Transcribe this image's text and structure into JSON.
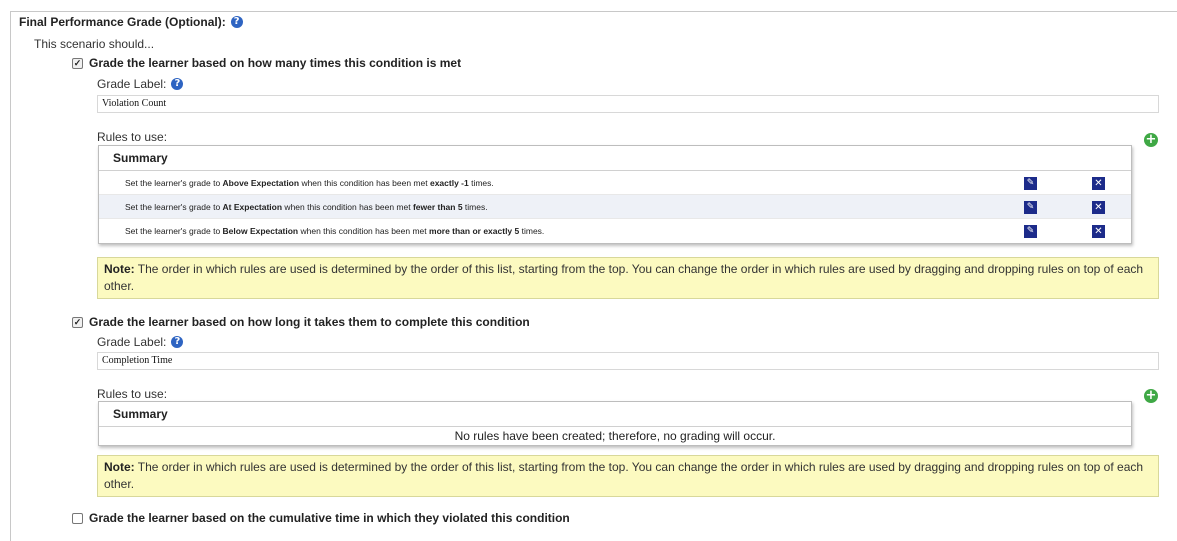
{
  "legend": {
    "label": "Final Performance Grade (Optional):",
    "help_icon": "question-circle-icon"
  },
  "intro": "This scenario should...",
  "sections": [
    {
      "checked": true,
      "checkbox_label": "Grade the learner based on how many times this condition is met",
      "grade_label": "Grade Label:",
      "grade_value": "Violation Count",
      "rules_label": "Rules to use:",
      "table_header": "Summary",
      "rules": [
        {
          "prefix": "Set the learner's grade to ",
          "grade": "Above Expectation",
          "middle": " when this condition has been met ",
          "cond": "exactly -1",
          "suffix": " times."
        },
        {
          "prefix": "Set the learner's grade to ",
          "grade": "At Expectation",
          "middle": " when this condition has been met ",
          "cond": "fewer than 5",
          "suffix": " times."
        },
        {
          "prefix": "Set the learner's grade to ",
          "grade": "Below Expectation",
          "middle": " when this condition has been met ",
          "cond": "more than or exactly 5",
          "suffix": " times."
        }
      ],
      "note_title": "Note:",
      "note_text": " The order in which rules are used is determined by the order of this list, starting from the top. You can change the order in which rules are used by dragging and dropping rules on top of each other."
    },
    {
      "checked": true,
      "checkbox_label": "Grade the learner based on how long it takes them to complete this condition",
      "grade_label": "Grade Label:",
      "grade_value": "Completion Time",
      "rules_label": "Rules to use:",
      "table_header": "Summary",
      "empty_text": "No rules have been created; therefore, no grading will occur.",
      "note_title": "Note:",
      "note_text": " The order in which rules are used is determined by the order of this list, starting from the top. You can change the order in which rules are used by dragging and dropping rules on top of each other."
    },
    {
      "checked": false,
      "checkbox_label": "Grade the learner based on the cumulative time in which they violated this condition"
    }
  ],
  "colors": {
    "accent_blue": "#2e64c2",
    "action_navy": "#1c2b8a",
    "add_green": "#3fa845",
    "note_bg": "#fcfac0",
    "alt_row": "#eef1f7"
  }
}
